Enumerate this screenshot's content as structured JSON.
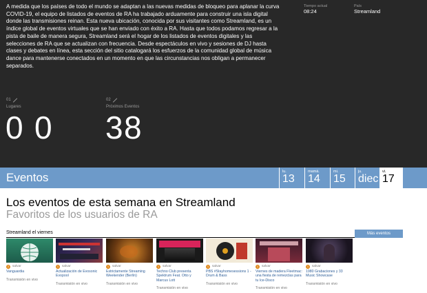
{
  "intro": "A medida que los países de todo el mundo se adaptan a las nuevas medidas de bloqueo para aplanar la curva COVID-19, el equipo de listados de eventos de RA ha trabajado arduamente para construir una isla digital donde las transmisiones reinan. Esta nueva ubicación, conocida por sus visitantes como Streamland, es un índice global de eventos virtuales que se han enviado con éxito a RA. Hasta que todos podamos regresar a la pista de baile de manera segura, Streamland será el hogar de los listados de eventos digitales y las selecciones de RA que se actualizan con frecuencia. Desde espectáculos en vivo y sesiones de DJ hasta clases y debates en línea, esta sección del sitio catalogará los esfuerzos de la comunidad global de música dance para mantenerse conectados en un momento en que las circunstancias nos obligan a permanecer separados.",
  "meta": {
    "time_label": "Tiempo actual",
    "time_value": "08:24",
    "country_label": "País",
    "country_value": "Streamland"
  },
  "stats": {
    "places_num": "01",
    "places_label": "Lugares",
    "places_digits": [
      "0",
      "0"
    ],
    "events_num": "02",
    "events_label": "Próximos Eventos",
    "events_digits": [
      "3",
      "8"
    ]
  },
  "events_bar": {
    "title": "Eventos",
    "days": [
      {
        "name": "lu.",
        "num": "13"
      },
      {
        "name": "mamá.",
        "num": "14"
      },
      {
        "name": "mi.",
        "num": "15"
      },
      {
        "name": "ju.",
        "num": "diecis"
      },
      {
        "name": "vi.",
        "num": "17"
      }
    ]
  },
  "headline": "Los eventos de esta semana en Streamland",
  "subhead": "Favoritos de los usuarios de RA",
  "section": {
    "title": "Streamland el viernes",
    "more": "Más eventos"
  },
  "cards": [
    {
      "count": "2",
      "save": "salvar",
      "title": "Vanguardia",
      "status": "Transmisión en vivo"
    },
    {
      "count": "1",
      "save": "salvar",
      "title": "Actualización de Evosonic Evopool",
      "status": "Transmisión en vivo"
    },
    {
      "count": "1",
      "save": "salvar",
      "title": "Estrictamente Streaming Weekender (Berlín)",
      "status": "Transmisión en vivo"
    },
    {
      "count": "1",
      "save": "salvar",
      "title": "Techno Club presenta Spektrum Feat. Otto y Marcus Lott",
      "status": "Transmisión en vivo"
    },
    {
      "count": "1",
      "save": "salvar",
      "title": "PBS #Stayhomesessions 1 - Drum & Bass",
      "status": "Transmisión en vivo"
    },
    {
      "count": "1",
      "save": "salvar",
      "title": "Viernes de madera Fleetmac: una fiesta de remezclas para tu Ice-Disco",
      "status": "Transmisión en vivo"
    },
    {
      "count": "1",
      "save": "salvar",
      "title": "1980 Grabaciones y 33 Music Showcase",
      "status": "Transmisión en vivo"
    }
  ],
  "colors": {
    "top_bg": "#282828",
    "accent": "#6d9ac9",
    "badge": "#e08a1e",
    "link": "#2f5f99"
  }
}
